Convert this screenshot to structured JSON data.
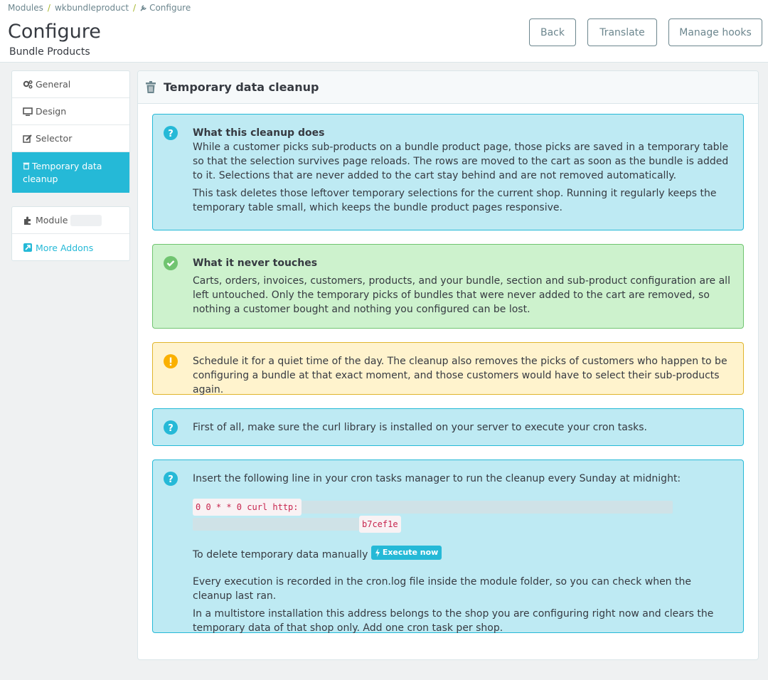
{
  "breadcrumb": {
    "items": [
      "Modules",
      "wkbundleproduct",
      "Configure"
    ]
  },
  "header": {
    "title": "Configure",
    "subtitle": "Bundle Products"
  },
  "toolbar": {
    "back": "Back",
    "translate": "Translate",
    "manage_hooks": "Manage hooks"
  },
  "sidebar": {
    "items": [
      {
        "label": "General",
        "icon": "gears-icon"
      },
      {
        "label": "Design",
        "icon": "desktop-icon"
      },
      {
        "label": "Selector",
        "icon": "edit-icon"
      },
      {
        "label": "Temporary data cleanup",
        "icon": "trash-icon",
        "active": true
      }
    ],
    "extra": [
      {
        "label": "Module",
        "icon": "puzzle-icon"
      },
      {
        "label": "More Addons",
        "icon": "external-link-icon"
      }
    ]
  },
  "panel": {
    "title": "Temporary data cleanup",
    "alerts": {
      "what": {
        "title": "What this cleanup does",
        "p1": "While a customer picks sub-products on a bundle product page, those picks are saved in a temporary table so that the selection survives page reloads. The rows are moved to the cart as soon as the bundle is added to it. Selections that are never added to the cart stay behind and are not removed automatically.",
        "p2": "This task deletes those leftover temporary selections for the current shop. Running it regularly keeps the temporary table small, which keeps the bundle product pages responsive."
      },
      "never": {
        "title": "What it never touches",
        "p1": "Carts, orders, invoices, customers, products, and your bundle, section and sub-product configuration are all left untouched. Only the temporary picks of bundles that were never added to the cart are removed, so nothing a customer bought and nothing you configured can be lost."
      },
      "warning": {
        "p1": "Schedule it for a quiet time of the day. The cleanup also removes the picks of customers who happen to be configuring a bundle at that exact moment, and those customers would have to select their sub-products again."
      },
      "curl": {
        "p1": "First of all, make sure the curl library is installed on your server to execute your cron tasks."
      },
      "cron": {
        "intro": "Insert the following line in your cron tasks manager to run the cleanup every Sunday at midnight:",
        "code_start": "0 0 * * 0 curl http:",
        "code_end": "b7cef1e",
        "manual_label": "To delete temporary data manually",
        "execute_btn": "Execute now",
        "p2": "Every execution is recorded in the cron.log file inside the module folder, so you can check when the cleanup last ran.",
        "p3": "In a multistore installation this address belongs to the shop you are configuring right now and clears the temporary data of that shop only. Add one cron task per shop."
      }
    }
  },
  "colors": {
    "accent": "#25b9d7",
    "info_bg": "#beeaf3",
    "success_bg": "#cdf2cd",
    "warning_bg": "#fff3cd"
  }
}
